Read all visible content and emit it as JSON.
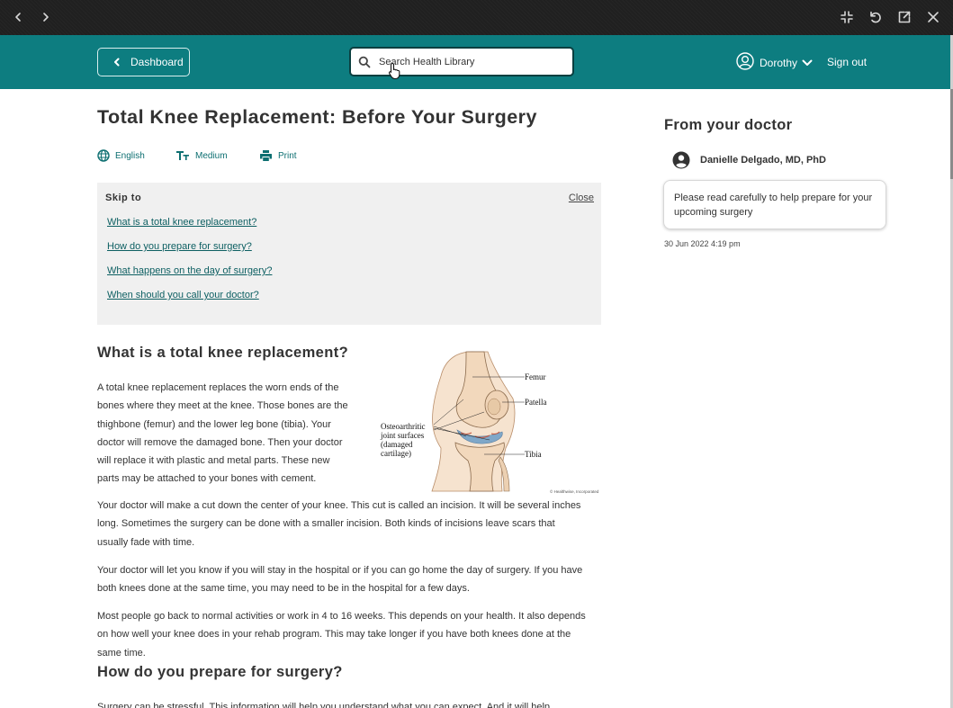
{
  "header": {
    "dashboard_label": "Dashboard",
    "search_placeholder": "Search Health Library",
    "user_name": "Dorothy",
    "signout_label": "Sign out"
  },
  "article": {
    "title": "Total Knee Replacement: Before Your Surgery",
    "tools": [
      {
        "label": "English",
        "icon": "globe-icon"
      },
      {
        "label": "Medium",
        "icon": "text-size-icon"
      },
      {
        "label": "Print",
        "icon": "print-icon"
      }
    ],
    "skip": {
      "title": "Skip to",
      "close_label": "Close",
      "links": [
        "What is a total knee replacement?",
        "How do you prepare for surgery?",
        "What happens on the day of surgery?",
        "When should you call your doctor?"
      ]
    },
    "section1": {
      "heading": "What is a total knee replacement?",
      "paragraphs": [
        "A total knee replacement replaces the worn ends of the bones where they meet at the knee. Those bones are the thighbone (femur) and the lower leg bone (tibia). Your doctor will remove the damaged bone. Then your doctor will replace it with plastic and metal parts. These new parts may be attached to your bones with cement.",
        "Your doctor will make a cut down the center of your knee. This cut is called an incision. It will be several inches long. Sometimes the surgery can be done with a smaller incision. Both kinds of incisions leave scars that usually fade with time.",
        "Your doctor will let you know if you will stay in the hospital or if you can go home the day of surgery. If you have both knees done at the same time, you may need to be in the hospital for a few days.",
        "Most people go back to normal activities or work in 4 to 16 weeks. This depends on your health. It also depends on how well your knee does in your rehab program. This may take longer if you have both knees done at the same time."
      ]
    },
    "diagram": {
      "labels": {
        "femur": "Femur",
        "patella": "Patella",
        "tibia": "Tibia",
        "osteo_line1": "Osteoarthritic",
        "osteo_line2": "joint surfaces",
        "osteo_line3": "(damaged",
        "osteo_line4": "cartilage)",
        "credit": "© Healthwise, Incorporated"
      }
    },
    "section2": {
      "heading": "How do you prepare for surgery?",
      "paragraph": "Surgery can be stressful. This information will help you understand what you can expect. And it will help"
    }
  },
  "sidebar": {
    "title": "From your doctor",
    "doctor_name": "Danielle Delgado, MD, PhD",
    "message": "Please read carefully to help prepare for your upcoming surgery",
    "timestamp": "30 Jun 2022 4:19 pm"
  },
  "colors": {
    "header_teal": "#0d7d80",
    "link_teal": "#0d5f62",
    "chrome_dark": "#202020",
    "skip_bg": "#f0f0f0"
  }
}
